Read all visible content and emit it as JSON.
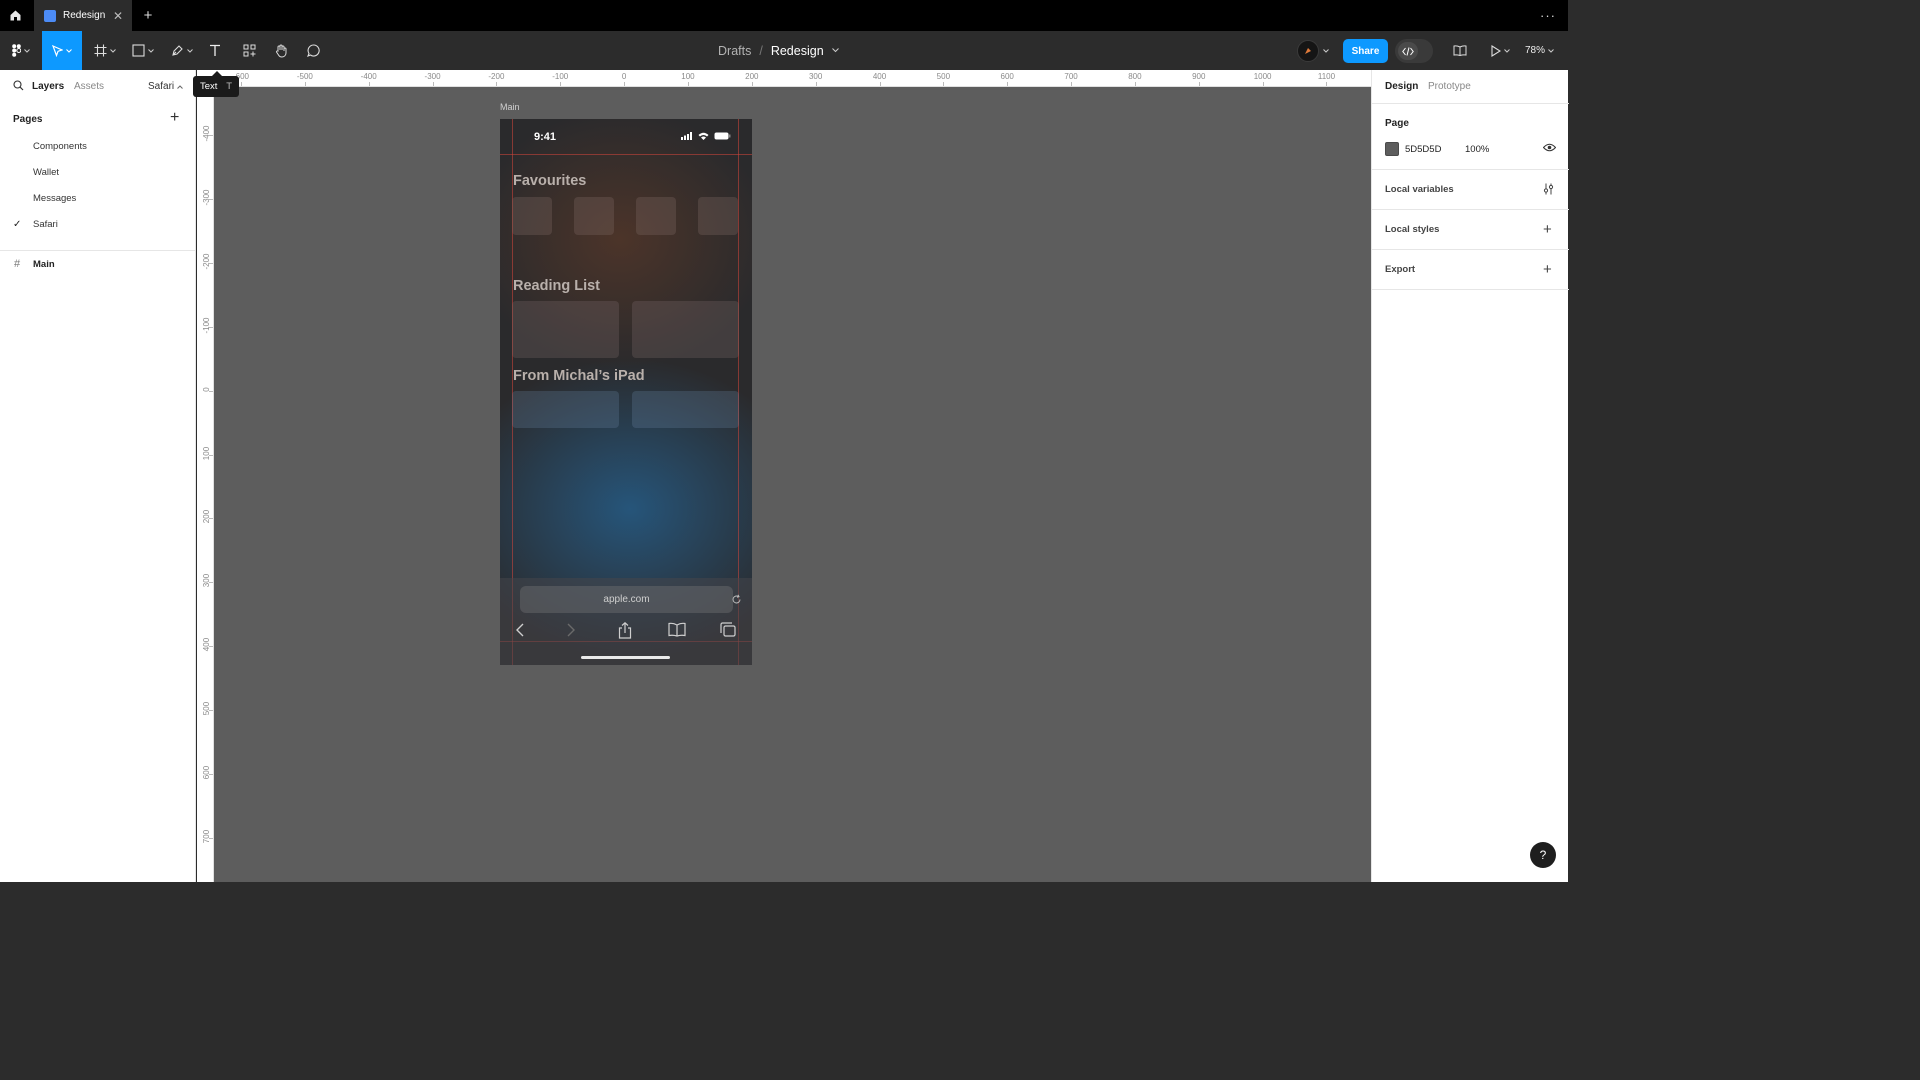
{
  "tabbar": {
    "file_tab_title": "Redesign",
    "close_glyph": "✕",
    "new_tab_glyph": "+",
    "more_glyph": "···"
  },
  "toolbar": {
    "breadcrumb_parent": "Drafts",
    "breadcrumb_separator": "/",
    "breadcrumb_current": "Redesign",
    "share_label": "Share",
    "zoom_level": "78%"
  },
  "tooltip": {
    "label": "Text",
    "shortcut": "T"
  },
  "left_panel": {
    "tab_layers": "Layers",
    "tab_assets": "Assets",
    "current_page": "Safari",
    "pages_heading": "Pages",
    "pages": [
      {
        "name": "Components",
        "selected": false
      },
      {
        "name": "Wallet",
        "selected": false
      },
      {
        "name": "Messages",
        "selected": false
      },
      {
        "name": "Safari",
        "selected": true
      }
    ],
    "layers": [
      {
        "name": "Main",
        "icon": "frame-icon"
      }
    ]
  },
  "canvas": {
    "background_color": "#5D5D5D",
    "hruler_labels": [
      "-600",
      "-500",
      "-400",
      "-300",
      "-200",
      "-100",
      "0",
      "100",
      "200",
      "300",
      "400",
      "500",
      "600",
      "700",
      "800",
      "900",
      "1000",
      "1100"
    ],
    "vruler_labels": [
      "-400",
      "-300",
      "-200",
      "-100",
      "0",
      "100",
      "200",
      "300",
      "400",
      "500",
      "600",
      "700"
    ],
    "frame": {
      "label": "Main",
      "status_time": "9:41",
      "sections": [
        "Favourites",
        "Reading List",
        "From Michal’s iPad"
      ],
      "url": "apple.com"
    }
  },
  "right_panel": {
    "tab_design": "Design",
    "tab_prototype": "Prototype",
    "page_heading": "Page",
    "page_color_hex": "5D5D5D",
    "page_opacity": "100%",
    "local_variables": "Local variables",
    "local_styles": "Local styles",
    "export": "Export",
    "help": "?"
  },
  "colors": {
    "accent": "#0d99ff",
    "toolbar_bg": "#2c2c2c",
    "tabbar_bg": "#000000",
    "active_tool": "#0d99ff"
  }
}
